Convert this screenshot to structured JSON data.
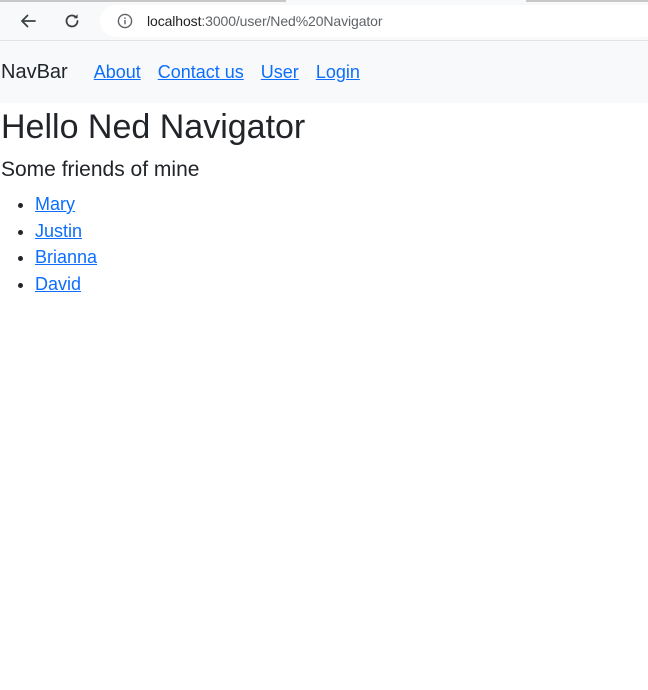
{
  "browser": {
    "url_host": "localhost",
    "url_path": ":3000/user/Ned%20Navigator"
  },
  "navbar": {
    "brand": "NavBar",
    "links": [
      "About",
      "Contact us",
      "User",
      "Login"
    ]
  },
  "main": {
    "title": "Hello Ned Navigator",
    "subtitle": "Some friends of mine",
    "friends": [
      "Mary",
      "Justin",
      "Brianna",
      "David"
    ]
  },
  "colors": {
    "link": "#0d6efd",
    "navbar_bg": "#f8f9fa",
    "text": "#212529"
  },
  "icons": {
    "back": "arrow-left-icon",
    "reload": "reload-icon",
    "site_info": "info-circle-icon"
  }
}
